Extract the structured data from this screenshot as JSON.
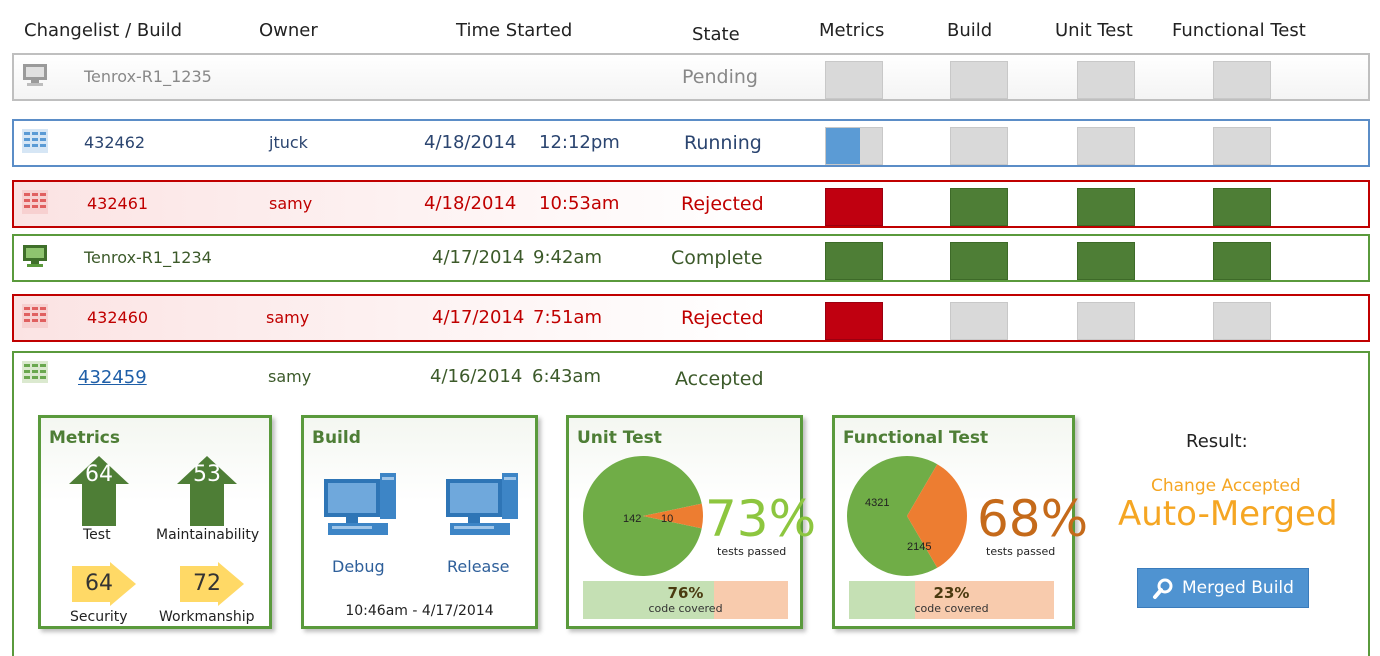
{
  "columns": {
    "changelist": "Changelist / Build",
    "owner": "Owner",
    "time_started": "Time Started",
    "state": "State",
    "metrics": "Metrics",
    "build": "Build",
    "unit_test": "Unit Test",
    "functional_test": "Functional Test"
  },
  "rows": [
    {
      "id": "Tenrox-R1_1235",
      "owner": "",
      "date": "",
      "time": "",
      "state": "Pending",
      "stages": [
        "pending",
        "pending",
        "pending",
        "pending"
      ]
    },
    {
      "id": "432462",
      "owner": "jtuck",
      "date": "4/18/2014",
      "time": "12:12pm",
      "state": "Running",
      "stages": [
        "running",
        "pending",
        "pending",
        "pending"
      ]
    },
    {
      "id": "432461",
      "owner": "samy",
      "date": "4/18/2014",
      "time": "10:53am",
      "state": "Rejected",
      "stages": [
        "failed",
        "passed",
        "passed",
        "passed"
      ]
    },
    {
      "id": "Tenrox-R1_1234",
      "owner": "",
      "date": "4/17/2014",
      "time": "9:42am",
      "state": "Complete",
      "stages": [
        "passed",
        "passed",
        "passed",
        "passed"
      ]
    },
    {
      "id": "432460",
      "owner": "samy",
      "date": "4/17/2014",
      "time": "7:51am",
      "state": "Rejected",
      "stages": [
        "failed",
        "pending",
        "pending",
        "pending"
      ]
    }
  ],
  "expanded": {
    "id": "432459",
    "owner": "samy",
    "date": "4/16/2014",
    "time": "6:43am",
    "state": "Accepted",
    "metrics": {
      "title": "Metrics",
      "test": {
        "value": "64",
        "label": "Test"
      },
      "maintainability": {
        "value": "53",
        "label": "Maintainability"
      },
      "security": {
        "value": "64",
        "label": "Security"
      },
      "workmanship": {
        "value": "72",
        "label": "Workmanship"
      }
    },
    "build": {
      "title": "Build",
      "debug": "Debug",
      "release": "Release",
      "timestamp": "10:46am - 4/17/2014"
    },
    "unit_test": {
      "title": "Unit Test",
      "passed": 142,
      "failed": 10,
      "passed_label": "142",
      "failed_label": "10",
      "pct": "73%",
      "pct_label": "tests passed",
      "coverage": "76%",
      "coverage_fraction": 0.64,
      "coverage_label": "code covered"
    },
    "functional_test": {
      "title": "Functional Test",
      "passed": 4321,
      "failed": 2145,
      "passed_label": "4321",
      "failed_label": "2145",
      "pct": "68%",
      "pct_label": "tests passed",
      "coverage": "23%",
      "coverage_fraction": 0.32,
      "coverage_label": "code covered"
    },
    "result": {
      "heading": "Result:",
      "subtitle": "Change Accepted",
      "title": "Auto-Merged",
      "button": "Merged Build"
    }
  },
  "colors": {
    "passed": "#4e7e36",
    "failed": "#c00010",
    "running": "#5b9bd5",
    "pending": "#d9d9d9",
    "pie_green": "#70ad47",
    "pie_orange": "#ed7d31",
    "accent_orange": "#f5a623"
  },
  "icons": {
    "pending": "computer-gray-icon",
    "running": "changelist-blue-icon",
    "rejected": "changelist-red-icon",
    "complete": "computer-green-icon",
    "accepted": "changelist-green-icon",
    "search": "search-icon"
  }
}
